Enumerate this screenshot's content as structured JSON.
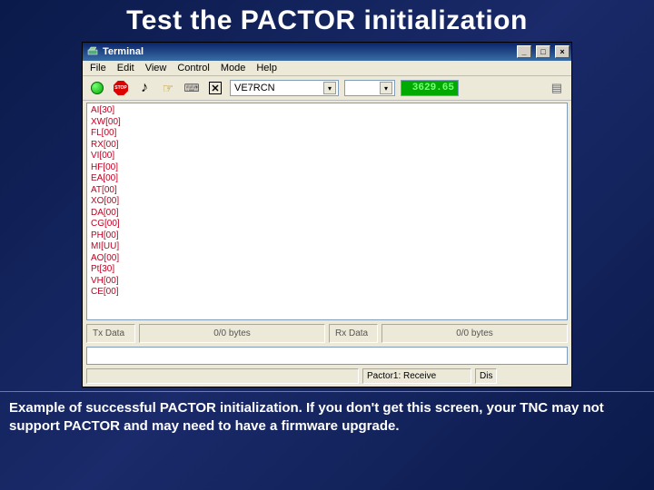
{
  "slide": {
    "title": "Test the PACTOR initialization",
    "caption": "Example of successful PACTOR initialization. If you don't get this screen, your TNC may not support PACTOR and may need to have a firmware upgrade."
  },
  "window": {
    "title": "Terminal",
    "menu": [
      "File",
      "Edit",
      "View",
      "Control",
      "Mode",
      "Help"
    ],
    "toolbar": {
      "callsign": "VE7RCN",
      "frequency": "3629.65"
    },
    "terminal_lines": [
      "AI[30]",
      "XW[00]",
      "FL[00]",
      "RX[00]",
      "VI[00]",
      "HF[00]",
      "EA[00]",
      "AT[00]",
      "XO[00]",
      "DA[00]",
      "CG[00]",
      "PH[00]",
      "MI[UU]",
      "AO[00]",
      "Pt[30]",
      "VH[00]",
      "CE[00]"
    ],
    "tx_label": "Tx Data",
    "rx_label": "Rx Data",
    "tx_bytes": "0/0 bytes",
    "rx_bytes": "0/0 bytes",
    "status_mode": "Pactor1: Receive",
    "status_right": "Dis"
  }
}
